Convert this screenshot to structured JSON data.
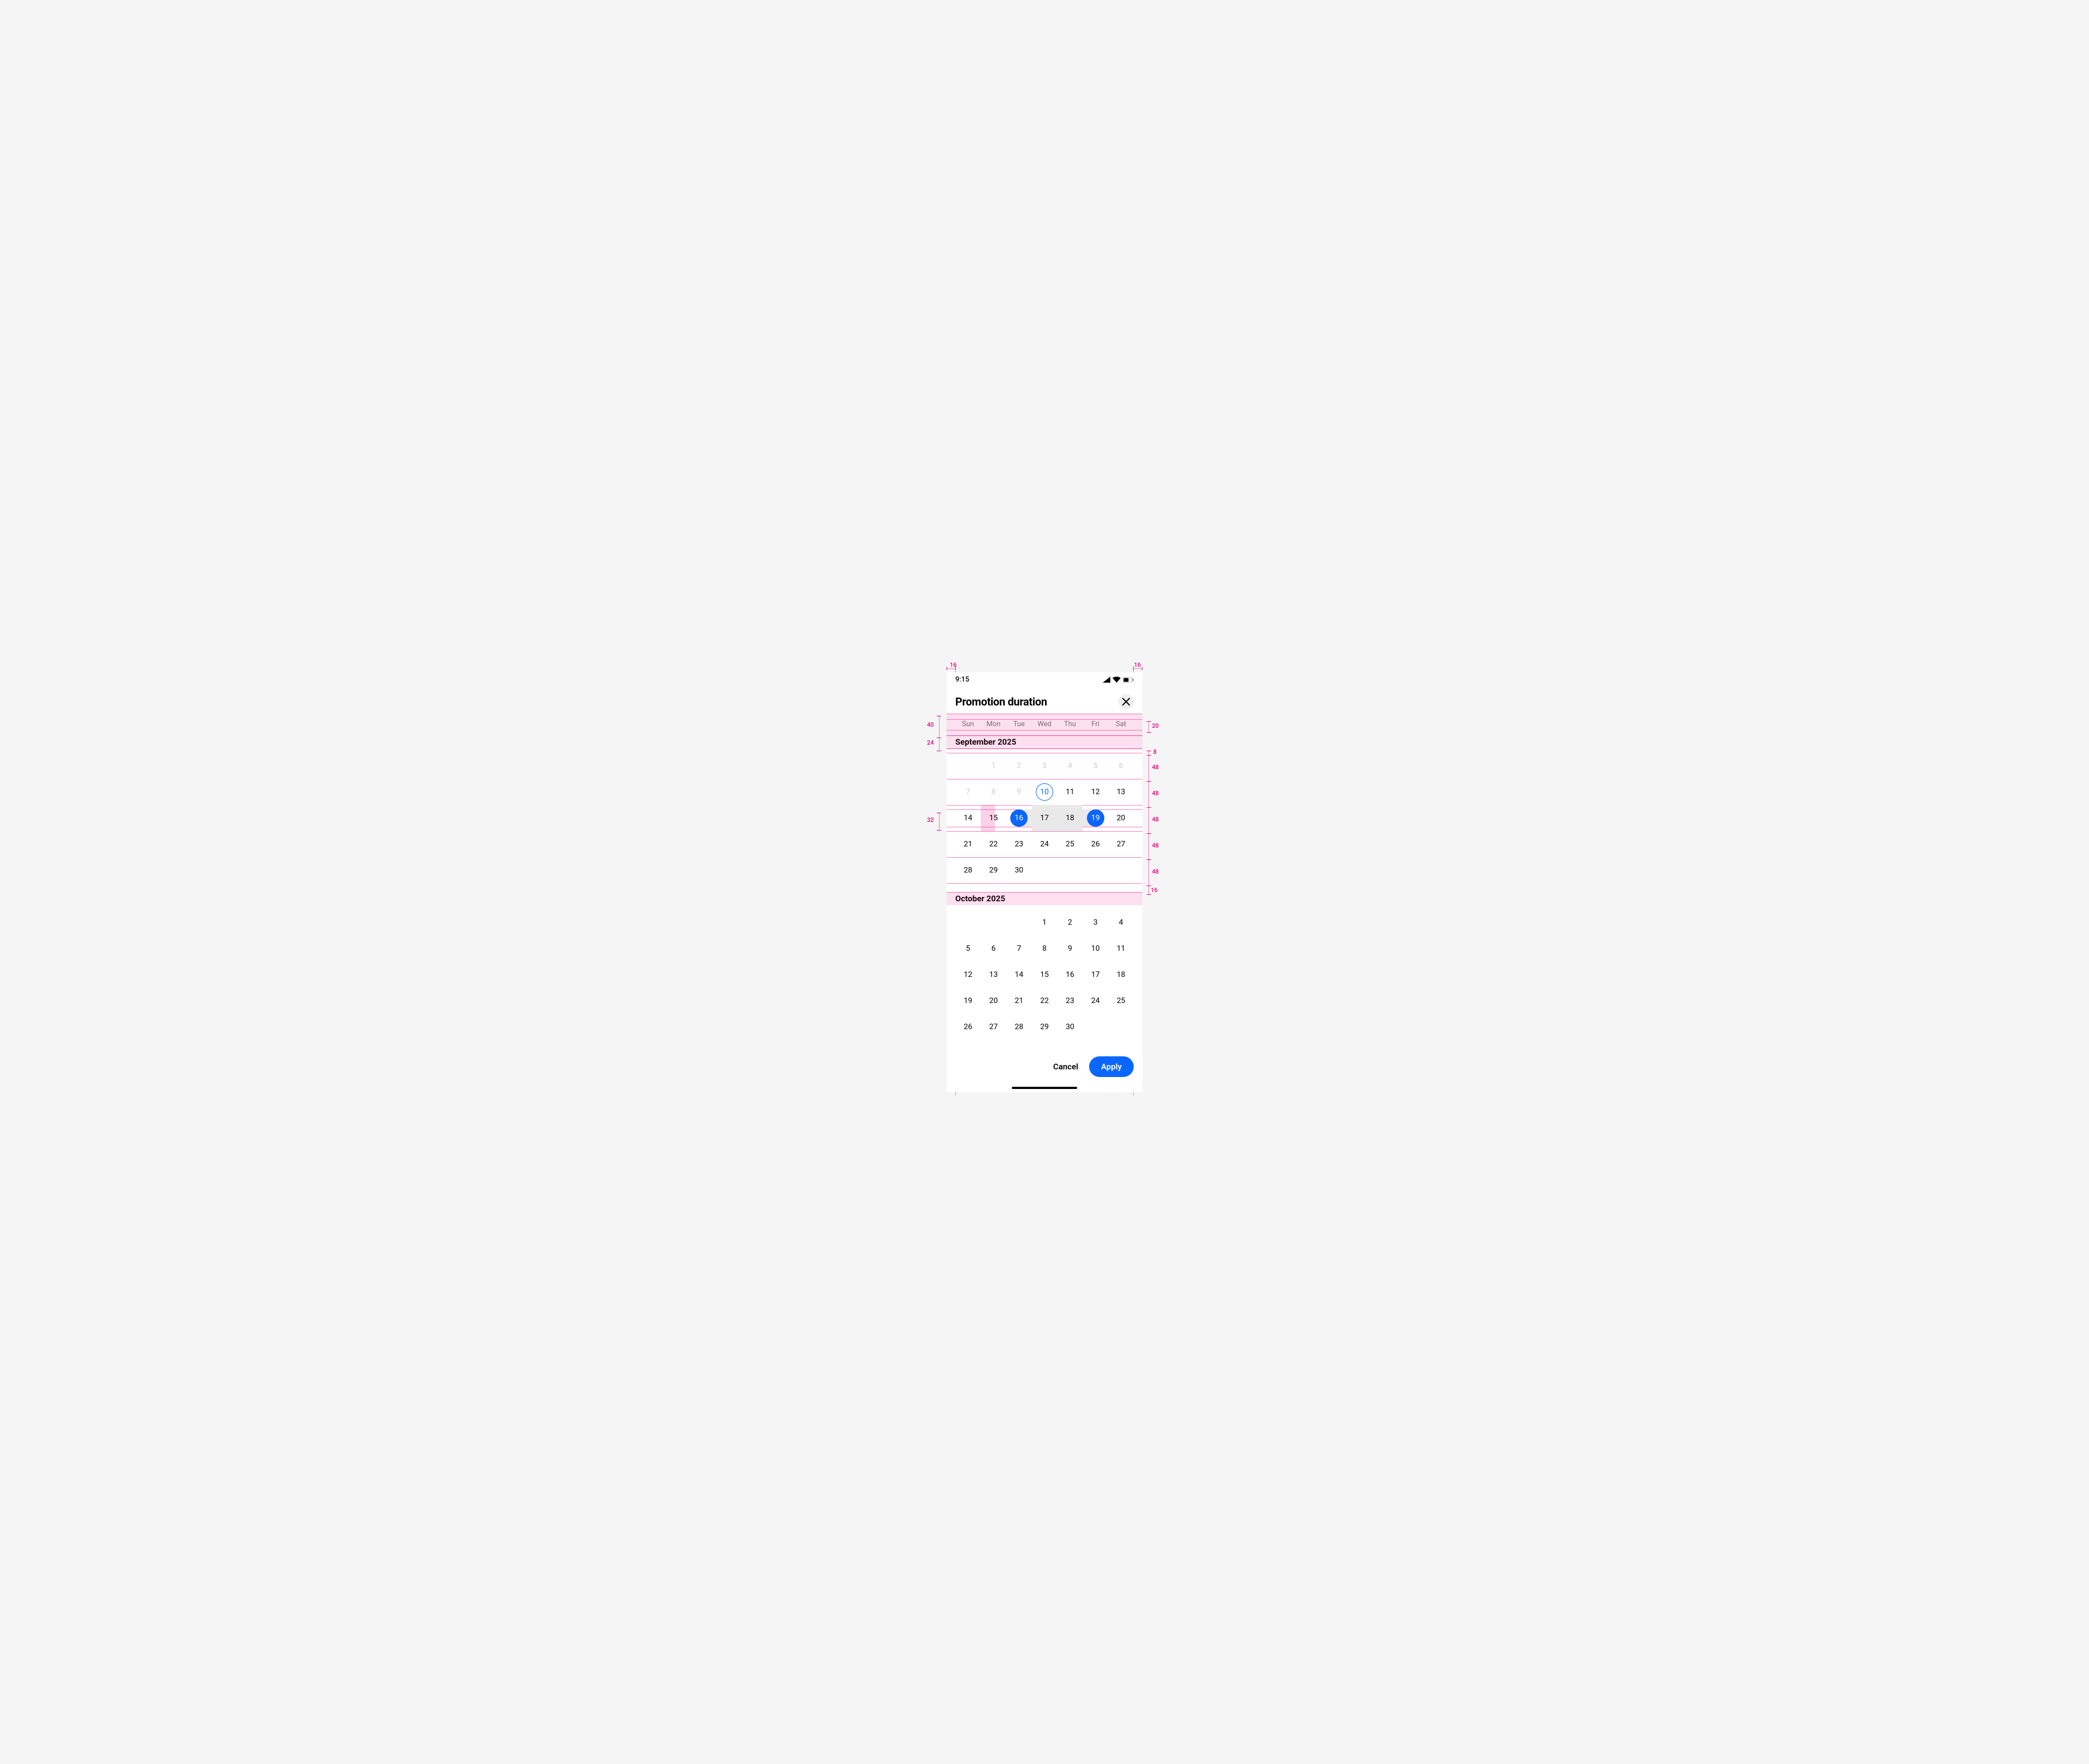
{
  "status": {
    "time": "9:15"
  },
  "header": {
    "title": "Promotion duration"
  },
  "weekdays": [
    "Sun",
    "Mon",
    "Tue",
    "Wed",
    "Thu",
    "Fri",
    "Sat"
  ],
  "months": {
    "sep": {
      "label": "September 2025"
    },
    "oct": {
      "label": "October 2025"
    }
  },
  "footer": {
    "cancel": "Cancel",
    "apply": "Apply"
  },
  "spec": {
    "pad_left": "16",
    "pad_right": "16",
    "weekday_row_h": "40",
    "weekday_txt_h": "20",
    "month_label_h": "24",
    "grid_top_pad": "8",
    "row_h_1": "48",
    "row_h_2": "48",
    "row_h_3": "48",
    "row_h_4": "48",
    "row_h_5": "48",
    "grid_bottom_pad": "16",
    "sel_circle": "32"
  },
  "colors": {
    "accent": "#0a66ff",
    "spec": "#e6007e"
  },
  "selection": {
    "start": 16,
    "end": 19,
    "today": 10
  }
}
